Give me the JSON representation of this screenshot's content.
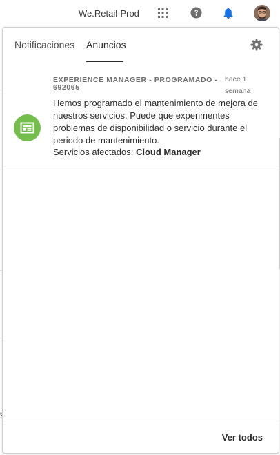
{
  "topbar": {
    "org_name": "We.Retail-Prod",
    "icons": [
      "apps-grid-icon",
      "help-icon",
      "bell-icon",
      "avatar"
    ],
    "bell_color": "#1473e6"
  },
  "background": {
    "edge_char": "e"
  },
  "popover": {
    "tabs": [
      {
        "label": "Notificaciones",
        "active": false
      },
      {
        "label": "Anuncios",
        "active": true
      }
    ],
    "settings_icon": "gear-icon",
    "announcement": {
      "icon": "news-icon",
      "icon_color": "#74bf4b",
      "header": "EXPERIENCE MANAGER - PROGRAMADO - 692065",
      "time": "hace 1 semana",
      "body": "Hemos programado el mantenimiento de mejora de nuestros servicios. Puede que experimentes problemas de disponibilidad o servicio durante el periodo de mantenimiento.",
      "services_label": "Servicios afectados: ",
      "services_value": "Cloud Manager"
    },
    "footer": {
      "view_all_label": "Ver todos"
    }
  }
}
